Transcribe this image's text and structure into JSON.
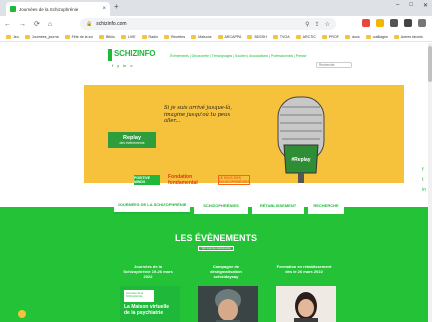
{
  "browser": {
    "tab_title": "Journées de la Schizophrénie",
    "tab_close": "×",
    "new_tab": "+",
    "url": "schizinfo.com",
    "bookmarks": [
      "Jeu",
      "Journées_journa",
      "Fête de la sci",
      "Biblio",
      "LIVE",
      "Radio",
      "Recettes",
      "Maisons",
      "ARCAPPA",
      "BDSSH",
      "TVOA",
      "ARCTIC",
      "PROF",
      "docs",
      "outillages",
      "Autres favoris"
    ]
  },
  "site": {
    "logo": "SCHIZINFO",
    "top_menu": "Événements | Découverte | Témoignages | Soutien | Associations | Professionnels | Presse",
    "search_placeholder": "Recherche",
    "social": [
      "f",
      "y",
      "in",
      "o"
    ]
  },
  "hero": {
    "replay_title": "Replay",
    "replay_sub": "des événements",
    "quote": "Si je suis arrivé jusque-là, imagine jusqu'où tu peux aller...",
    "hashtag": "#Replay"
  },
  "partners": [
    "POSITIVE MINDS",
    "Fondation fondamental",
    "LE MOIS DES SCHIZOPHRÉNIES"
  ],
  "nav": {
    "tabs": [
      "JOURNÉES DE LA SCHIZOPHRÉNIE",
      "SCHIZOPHRÉNIES",
      "RÉTABLISSEMENT",
      "RECHERCHE"
    ]
  },
  "events": {
    "title": "LES ÉVÈNEMENTS",
    "button": "Voir tous les événements",
    "items": [
      {
        "title": "Journées de la Schizophrénie 19-26 mars 2022"
      },
      {
        "title": "Campagne de déstigmatisation schizidaysay"
      },
      {
        "title": "Formation en rétablissement dès le 26 mars 2022"
      }
    ],
    "card1_brand": "Journées de la Schizophrénie",
    "card1_text": "La Maison virtuelle de la psychiatrie"
  },
  "colors": {
    "green": "#23c237",
    "yellow": "#f6c23c"
  }
}
